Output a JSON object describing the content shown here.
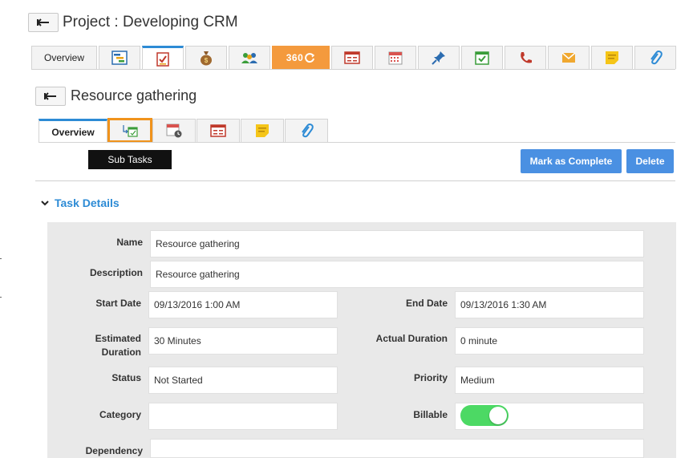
{
  "project": {
    "title": "Project : Developing CRM"
  },
  "project_tabs": [
    {
      "label": "Overview",
      "type": "label"
    },
    {
      "icon": "gantt-chart-icon",
      "type": "icon"
    },
    {
      "icon": "task-checklist-icon",
      "type": "icon",
      "active": true
    },
    {
      "icon": "money-bag-icon",
      "type": "icon"
    },
    {
      "icon": "team-icon",
      "type": "icon"
    },
    {
      "label": "360",
      "icon": "refresh-360-icon",
      "type": "orange"
    },
    {
      "icon": "form-icon",
      "type": "icon"
    },
    {
      "icon": "calendar-icon",
      "type": "icon"
    },
    {
      "icon": "pin-icon",
      "type": "icon"
    },
    {
      "icon": "calendar-check-icon",
      "type": "icon"
    },
    {
      "icon": "phone-icon",
      "type": "icon"
    },
    {
      "icon": "email-icon",
      "type": "icon"
    },
    {
      "icon": "sticky-note-icon",
      "type": "icon"
    },
    {
      "icon": "paperclip-icon",
      "type": "icon"
    }
  ],
  "task": {
    "title": "Resource gathering"
  },
  "task_tabs": {
    "overview_label": "Overview",
    "icons": [
      "sub-tasks-icon",
      "calendar-clock-icon",
      "form-icon",
      "sticky-note-icon",
      "paperclip-icon"
    ]
  },
  "tooltip": {
    "text": "Sub Tasks"
  },
  "actions": {
    "complete_label": "Mark as Complete",
    "delete_label": "Delete"
  },
  "section": {
    "title": "Task Details"
  },
  "details": {
    "name_label": "Name",
    "name_value": "Resource gathering",
    "description_label": "Description",
    "description_value": "Resource gathering",
    "start_label": "Start Date",
    "start_value": "09/13/2016 1:00 AM",
    "end_label": "End Date",
    "end_value": "09/13/2016 1:30 AM",
    "est_label_1": "Estimated",
    "est_label_2": "Duration",
    "est_value": "30 Minutes",
    "actual_label": "Actual Duration",
    "actual_value": "0 minute",
    "status_label": "Status",
    "status_value": "Not Started",
    "priority_label": "Priority",
    "priority_value": "Medium",
    "category_label": "Category",
    "category_value": "",
    "billable_label": "Billable",
    "billable_on": true,
    "dependency_label": "Dependency",
    "dependency_value": ""
  },
  "colors": {
    "accent": "#2d8bd5",
    "button": "#4a90e2",
    "orange": "#f49a3d",
    "toggle_on": "#4cd964",
    "highlight": "#f0931c"
  }
}
